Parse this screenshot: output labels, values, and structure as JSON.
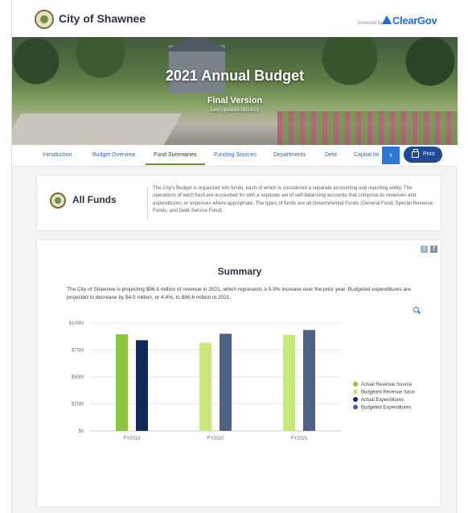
{
  "header": {
    "city_name": "City of Shawnee",
    "powered_by": "powered by",
    "brand_name": "ClearGov"
  },
  "hero": {
    "title": "2021 Annual Budget",
    "subtitle": "Final Version",
    "updated": "Last Updated 08/24/21"
  },
  "nav": {
    "tabs": [
      {
        "label": "Introduction",
        "active": false
      },
      {
        "label": "Budget Overview",
        "active": false
      },
      {
        "label": "Fund Summaries",
        "active": true
      },
      {
        "label": "Funding Sources",
        "active": false
      },
      {
        "label": "Departments",
        "active": false
      },
      {
        "label": "Debt",
        "active": false
      },
      {
        "label": "Capital Im",
        "active": false
      }
    ],
    "next_arrow": "›",
    "print_label": "Print"
  },
  "funds": {
    "title": "All Funds",
    "description": "The City's Budget is organized into funds, each of which is considered a separate accounting and reporting entity. The operations of each fund are accounted for with a separate set of self-balancing accounts that comprise its revenues and expenditures, or expenses where appropriate. The types of funds are all Governmental Funds (General Fund, Special Revenue Funds, and Debt Service Fund)."
  },
  "summary": {
    "twitter": "t",
    "facebook": "f",
    "title": "Summary",
    "description": "The City of Shawnee is projecting $86.8 million of revenue in 2021, which represents a 5.9% increase over the prior year. Budgeted expenditures are projected to decrease by $4.0 million, or 4.4%, to $86.6 million in 2021."
  },
  "colors": {
    "actual_revenue": "#8cc63f",
    "budgeted_revenue": "#c8e87e",
    "actual_expenditures": "#0f2a5a",
    "budgeted_expenditures": "#4a6485",
    "accent": "#2b78d6"
  },
  "chart_data": {
    "type": "bar",
    "categories": [
      "FY2019",
      "FY2020",
      "FY2021"
    ],
    "series": [
      {
        "name": "Actual Revenue Source",
        "values": [
          89.5,
          null,
          null
        ]
      },
      {
        "name": "Budgeted Revenue Source",
        "values": [
          null,
          81.5,
          89.0
        ]
      },
      {
        "name": "Actual Expenditures",
        "values": [
          84.0,
          null,
          null
        ]
      },
      {
        "name": "Budgeted Expenditures",
        "values": [
          null,
          90.0,
          93.5
        ]
      }
    ],
    "yticks": [
      "$0",
      "$25M",
      "$50M",
      "$75M",
      "$100M"
    ],
    "ylim": [
      0,
      100
    ],
    "grid": true,
    "legend": "right"
  }
}
